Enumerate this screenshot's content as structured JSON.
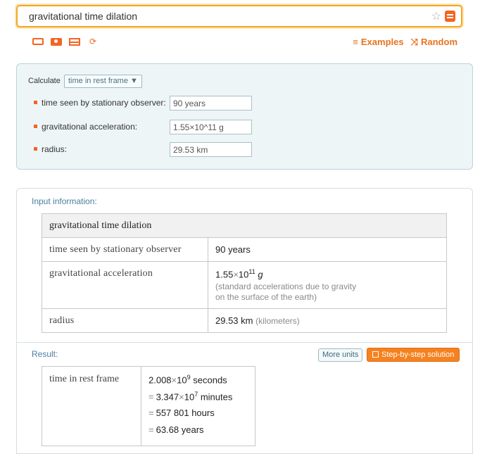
{
  "search": {
    "query": "gravitational time dilation"
  },
  "toolbar": {
    "examples_label": "Examples",
    "random_label": "Random",
    "icons": [
      "keyboard-icon",
      "camera-icon",
      "table-icon",
      "shuffle-input-icon"
    ]
  },
  "form": {
    "calculate_label": "Calculate",
    "calculate_value": "time in rest frame ▼",
    "fields": [
      {
        "label": "time seen by stationary observer:",
        "value": "90 years"
      },
      {
        "label": "gravitational acceleration:",
        "value": "1.55×10^11 g"
      },
      {
        "label": "radius:",
        "value": "29.53 km"
      }
    ]
  },
  "input_info": {
    "title": "Input information:",
    "header": "gravitational time dilation",
    "rows": [
      {
        "label": "time seen by stationary observer",
        "value": "90 years"
      },
      {
        "label": "gravitational acceleration",
        "value_base": "1.55",
        "value_exp": "11",
        "value_unit": "g",
        "note_line1": "(standard accelerations due to gravity",
        "note_line2": "on the surface of the earth)"
      },
      {
        "label": "radius",
        "value": "29.53 km",
        "note": "(kilometers)"
      }
    ]
  },
  "result": {
    "title": "Result:",
    "more_units_label": "More units",
    "step_label": "Step-by-step solution",
    "label": "time in rest frame",
    "lines": [
      {
        "prefix": "",
        "base": "2.008",
        "exp": "9",
        "unit": "seconds"
      },
      {
        "prefix": "=",
        "base": "3.347",
        "exp": "7",
        "unit": "minutes"
      },
      {
        "prefix": "=",
        "text": "557 801 hours"
      },
      {
        "prefix": "=",
        "text": "63.68 years"
      }
    ]
  },
  "colors": {
    "accent": "#f26522",
    "search_border": "#f5a623",
    "form_bg": "#eef5f7",
    "section_title": "#4a7fa0"
  }
}
